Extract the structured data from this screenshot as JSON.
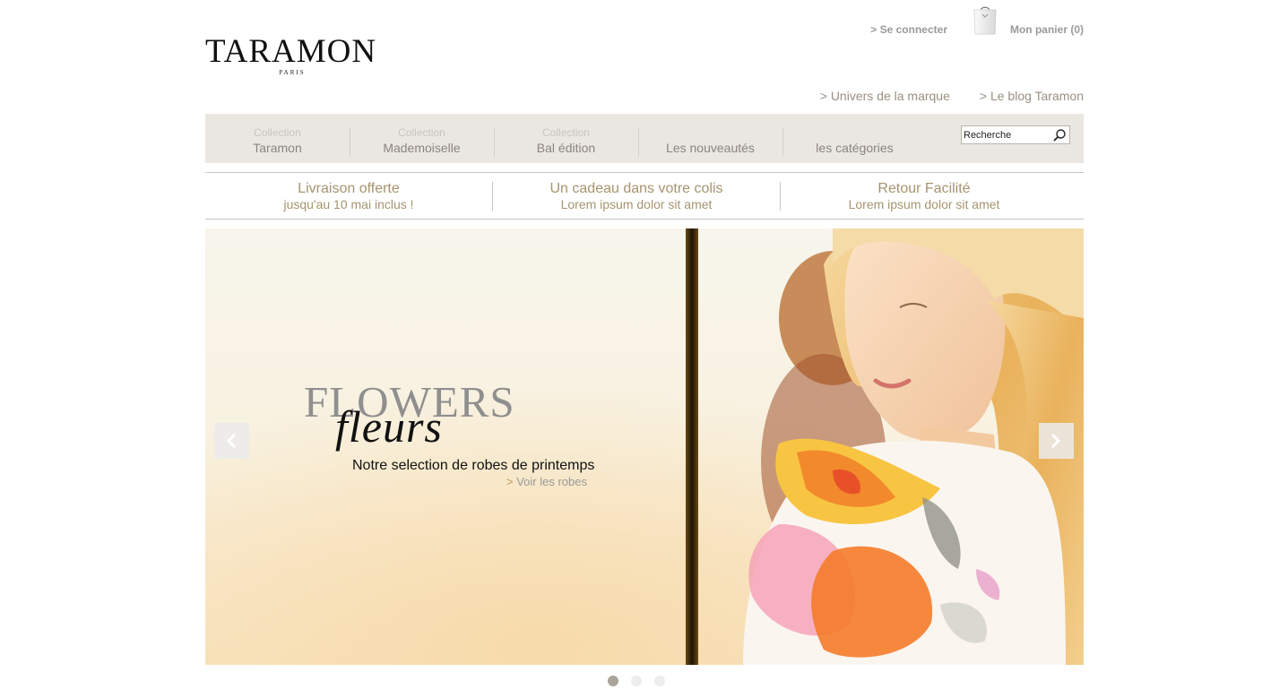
{
  "header": {
    "logo_text": "TARAMON",
    "logo_subtitle": "PARIS",
    "login_link": "> Se connecter",
    "cart_link": "Mon panier (0)",
    "brand_links": [
      "> Univers de la marque",
      "> Le blog Taramon"
    ]
  },
  "nav": {
    "items": [
      {
        "small": "Collection",
        "label": "Taramon"
      },
      {
        "small": "Collection",
        "label": "Mademoiselle"
      },
      {
        "small": "Collection",
        "label": "Bal édition"
      },
      {
        "small": "",
        "label": "Les nouveautés"
      },
      {
        "small": "",
        "label": "les catégories"
      }
    ],
    "search_placeholder": "Recherche"
  },
  "promo": [
    {
      "title": "Livraison offerte",
      "sub": "jusqu'au 10 mai inclus !"
    },
    {
      "title": "Un cadeau dans votre colis",
      "sub": "Lorem ipsum dolor sit amet"
    },
    {
      "title": "Retour Facilité",
      "sub": "Lorem ipsum dolor sit amet"
    }
  ],
  "hero": {
    "title": "FLOWERS",
    "script_title": "fleurs",
    "caption": "Notre selection de robes de printemps",
    "link_arrow": ">",
    "link_text": "Voir les robes",
    "slide_count": 3,
    "active_slide": 1
  },
  "icons": {
    "search": "search-icon",
    "bag": "shopping-bag-icon",
    "prev": "chevron-left-icon",
    "next": "chevron-right-icon"
  },
  "colors": {
    "accent": "#a69470",
    "nav_bg": "#eae7e2",
    "link_grey": "#9a9a9a"
  }
}
